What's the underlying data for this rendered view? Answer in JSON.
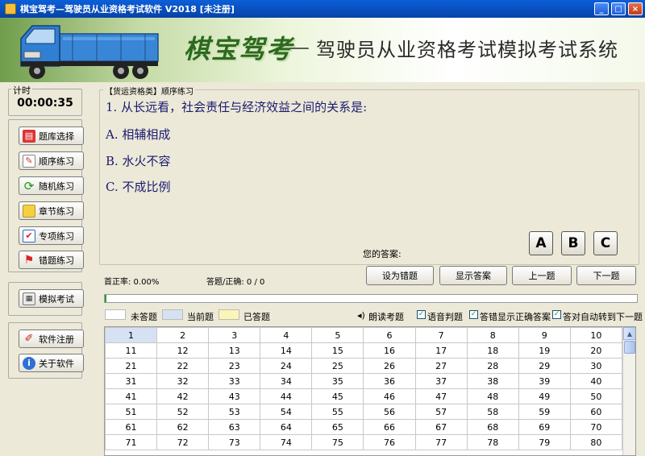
{
  "window": {
    "title": "棋宝驾考—驾驶员从业资格考试软件 V2018 [未注册]"
  },
  "banner": {
    "logo": "棋宝驾考",
    "dash": "—",
    "subtitle": "驾驶员从业资格考试模拟考试系统"
  },
  "timer": {
    "label": "计时",
    "value": "00:00:35"
  },
  "sidebar": {
    "items": [
      {
        "label": "题库选择",
        "icon": "books-icon"
      },
      {
        "label": "顺序练习",
        "icon": "edit-icon"
      },
      {
        "label": "随机练习",
        "icon": "refresh-icon"
      },
      {
        "label": "章节练习",
        "icon": "folder-icon"
      },
      {
        "label": "专项练习",
        "icon": "checklist-icon"
      },
      {
        "label": "错题练习",
        "icon": "flag-icon"
      },
      {
        "label": "模拟考试",
        "icon": "calculator-icon"
      },
      {
        "label": "软件注册",
        "icon": "pen-icon"
      },
      {
        "label": "关于软件",
        "icon": "info-icon"
      }
    ]
  },
  "question": {
    "category": "【货运资格类】顺序练习",
    "text": "1. 从长远看，社会责任与经济效益之间的关系是:",
    "options": [
      "A. 相辅相成",
      "B. 水火不容",
      "C. 不成比例"
    ]
  },
  "answer": {
    "label": "您的答案:",
    "buttons": [
      "A",
      "B",
      "C"
    ]
  },
  "stats": {
    "accuracy": "首正率: 0.00%",
    "answered": "答题/正确: 0 / 0"
  },
  "actions": {
    "wrong": "设为错题",
    "show": "显示答案",
    "prev": "上一题",
    "next": "下一题"
  },
  "progress": {
    "fraction": 0.003
  },
  "legend": {
    "unanswered": "未答题",
    "current": "当前题",
    "answered": "已答题",
    "read": "朗读考题",
    "voice": "语音判题",
    "show_correct": "答错显示正确答案",
    "auto_next": "答对自动转到下一题"
  },
  "grid": {
    "rows": [
      [
        "1",
        "2",
        "3",
        "4",
        "5",
        "6",
        "7",
        "8",
        "9",
        "10"
      ],
      [
        "11",
        "12",
        "13",
        "14",
        "15",
        "16",
        "17",
        "18",
        "19",
        "20"
      ],
      [
        "21",
        "22",
        "23",
        "24",
        "25",
        "26",
        "27",
        "28",
        "29",
        "30"
      ],
      [
        "31",
        "32",
        "33",
        "34",
        "35",
        "36",
        "37",
        "38",
        "39",
        "40"
      ],
      [
        "41",
        "42",
        "43",
        "44",
        "45",
        "46",
        "47",
        "48",
        "49",
        "50"
      ],
      [
        "51",
        "52",
        "53",
        "54",
        "55",
        "56",
        "57",
        "58",
        "59",
        "60"
      ],
      [
        "61",
        "62",
        "63",
        "64",
        "65",
        "66",
        "67",
        "68",
        "69",
        "70"
      ],
      [
        "71",
        "72",
        "73",
        "74",
        "75",
        "76",
        "77",
        "78",
        "79",
        "80"
      ]
    ]
  },
  "colors": {
    "current": "#d6e2f4",
    "answered": "#fdf5b8",
    "unanswered": "#ffffff",
    "title_bar": "#0A5FD8"
  }
}
